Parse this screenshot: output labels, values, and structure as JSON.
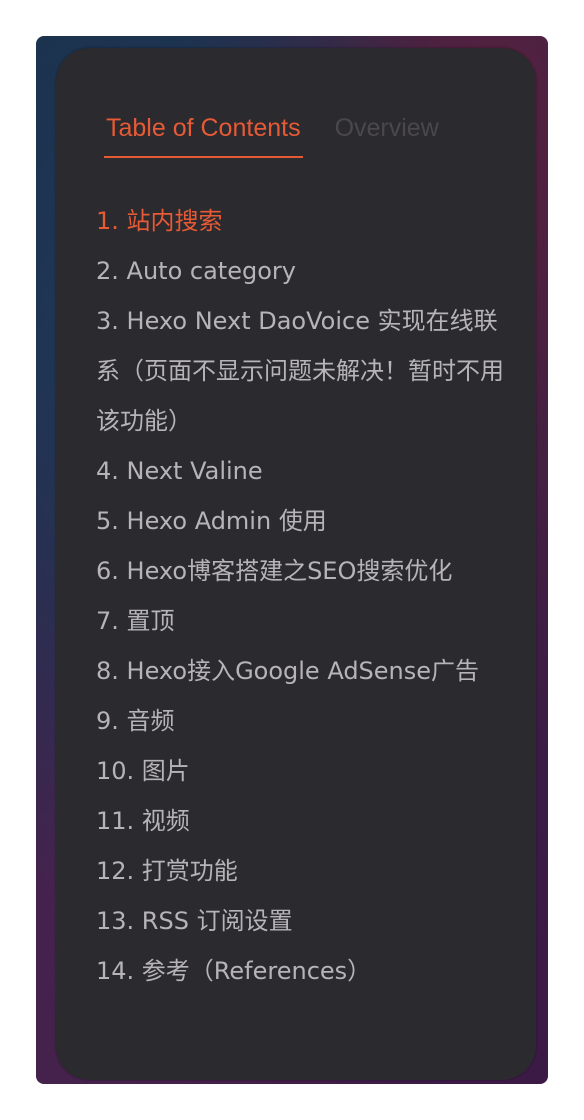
{
  "tabs": [
    {
      "label": "Table of Contents",
      "active": true
    },
    {
      "label": "Overview",
      "active": false
    }
  ],
  "toc": {
    "items": [
      {
        "text": "1. 站内搜索",
        "active": true
      },
      {
        "text": "2. Auto category"
      },
      {
        "text": "3. Hexo Next DaoVoice 实现在线联系（页面不显示问题未解决！暂时不用该功能）"
      },
      {
        "text": "4. Next Valine"
      },
      {
        "text": "5. Hexo Admin 使用"
      },
      {
        "text": "6. Hexo博客搭建之SEO搜索优化"
      },
      {
        "text": "7. 置顶"
      },
      {
        "text": "8. Hexo接入Google AdSense广告"
      },
      {
        "text": "9. 音频"
      },
      {
        "text": "10. 图片"
      },
      {
        "text": "11. 视频"
      },
      {
        "text": "12. 打赏功能"
      },
      {
        "text": "13. RSS 订阅设置"
      },
      {
        "text": "14. 参考（References）"
      }
    ]
  },
  "colors": {
    "accent": "#e65a36",
    "text": "#b6b4b8",
    "panel": "#2b2a2e",
    "inactive_tab": "#4a484d"
  }
}
